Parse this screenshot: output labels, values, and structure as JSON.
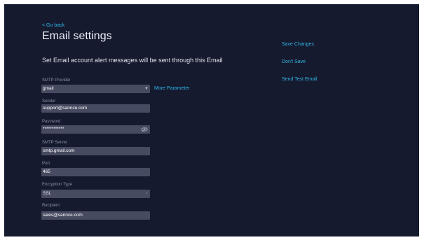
{
  "nav": {
    "back_label": "< Go back"
  },
  "page": {
    "title": "Email settings",
    "subtitle": "Set Email account alert messages will be sent through this Email"
  },
  "form": {
    "smtp_provider": {
      "label": "SMTP Provider",
      "value": "gmail"
    },
    "more_parameter_label": "More Parameter",
    "sender": {
      "label": "Sender",
      "value": "support@sannce.com"
    },
    "password": {
      "label": "Password",
      "value": "************"
    },
    "smtp_server": {
      "label": "SMTP Server",
      "value": "smtp.gmail.com"
    },
    "port": {
      "label": "Port",
      "value": "465"
    },
    "encryption_type": {
      "label": "Encryption Type",
      "value": "SSL"
    },
    "recipient": {
      "label": "Recipient",
      "value": "sales@sannce.com"
    }
  },
  "actions": {
    "save_changes": "Save Changes",
    "dont_save": "Don't Save",
    "send_test_email": "Send Test Email"
  },
  "icons": {
    "dropdown": "chevron-down-icon",
    "password_visibility": "eye-off-icon"
  },
  "colors": {
    "background": "#161a2e",
    "field_bg": "#474b61",
    "accent": "#2fb3e6",
    "label": "#8a90a6"
  }
}
